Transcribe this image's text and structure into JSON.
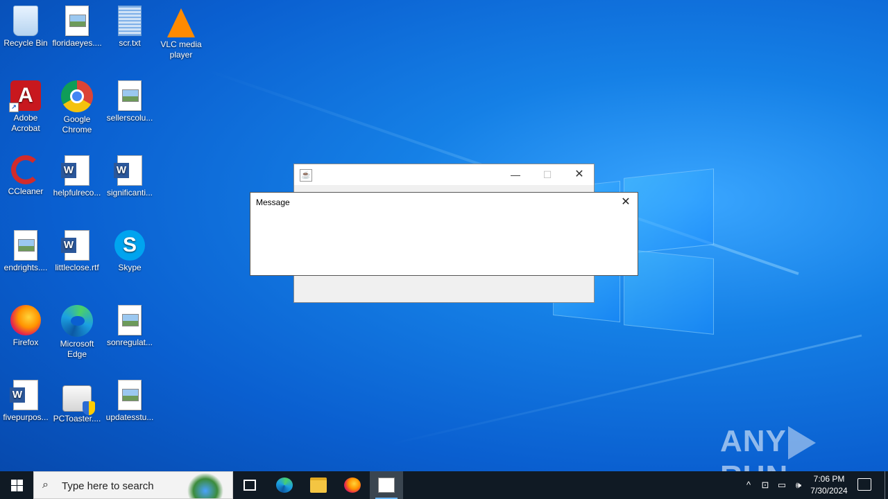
{
  "desktop": {
    "icons": [
      {
        "label": "Recycle Bin",
        "icon": "recycle-bin-icon"
      },
      {
        "label": "floridaeyes....",
        "icon": "image-file-icon"
      },
      {
        "label": "scr.txt",
        "icon": "text-file-icon"
      },
      {
        "label": "VLC media player",
        "icon": "vlc-icon"
      },
      {
        "label": "Adobe Acrobat",
        "icon": "adobe-acrobat-icon"
      },
      {
        "label": "Google Chrome",
        "icon": "chrome-icon"
      },
      {
        "label": "sellerscolu...",
        "icon": "image-file-icon"
      },
      {
        "label": "CCleaner",
        "icon": "ccleaner-icon"
      },
      {
        "label": "helpfulreco...",
        "icon": "word-doc-icon"
      },
      {
        "label": "significanti...",
        "icon": "word-doc-icon"
      },
      {
        "label": "endrights....",
        "icon": "image-file-icon"
      },
      {
        "label": "littleclose.rtf",
        "icon": "word-doc-icon"
      },
      {
        "label": "Skype",
        "icon": "skype-icon"
      },
      {
        "label": "Firefox",
        "icon": "firefox-icon"
      },
      {
        "label": "Microsoft Edge",
        "icon": "edge-icon"
      },
      {
        "label": "sonregulat...",
        "icon": "image-file-icon"
      },
      {
        "label": "fivepurpos...",
        "icon": "word-doc-icon"
      },
      {
        "label": "PCToaster....",
        "icon": "pctoaster-icon"
      },
      {
        "label": "updatesstu...",
        "icon": "image-file-icon"
      }
    ]
  },
  "java_window": {
    "minimize": "—",
    "maximize": "☐",
    "close": "✕"
  },
  "message_dialog": {
    "title": "Message",
    "close": "✕"
  },
  "watermark": {
    "left": "ANY",
    "right": "RUN"
  },
  "taskbar": {
    "search_placeholder": "Type here to search",
    "time": "7:06 PM",
    "date": "7/30/2024",
    "tray_chevron": "^"
  }
}
